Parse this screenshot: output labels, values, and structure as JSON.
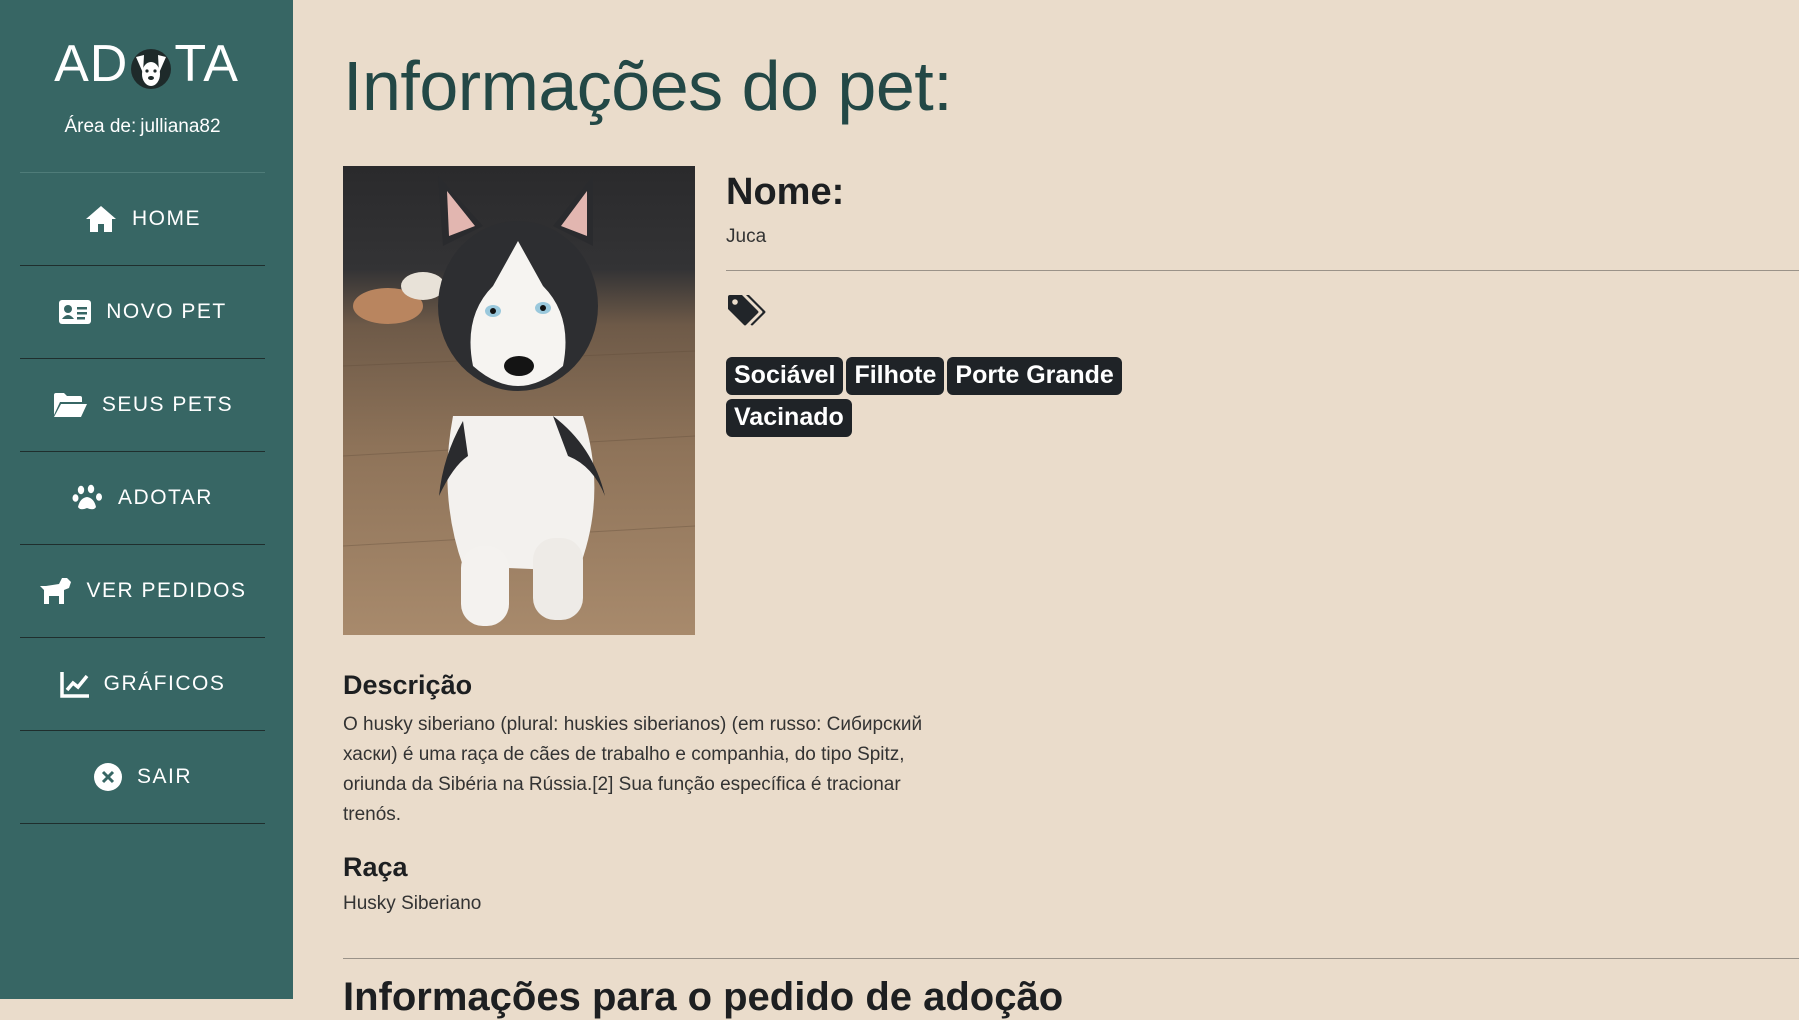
{
  "sidebar": {
    "logo_left": "AD",
    "logo_right": "TA",
    "area_label": "Área de:",
    "username": "julliana82",
    "items": [
      {
        "label": "HOME",
        "icon": "home-icon"
      },
      {
        "label": "NOVO PET",
        "icon": "id-card-icon"
      },
      {
        "label": "SEUS PETS",
        "icon": "folder-open-icon"
      },
      {
        "label": "ADOTAR",
        "icon": "paw-icon"
      },
      {
        "label": "VER PEDIDOS",
        "icon": "dog-icon"
      },
      {
        "label": "GRÁFICOS",
        "icon": "chart-line-icon"
      },
      {
        "label": "SAIR",
        "icon": "close-circle-icon"
      }
    ]
  },
  "main": {
    "title": "Informações do pet:",
    "nome_label": "Nome:",
    "nome_value": "Juca",
    "tags": [
      "Sociável",
      "Filhote",
      "Porte Grande",
      "Vacinado"
    ],
    "descricao_label": "Descrição",
    "descricao_text": "O husky siberiano (plural: huskies siberianos) (em russo: Сибирский хаски) é uma raça de cães de trabalho e companhia, do tipo Spitz, oriunda da Sibéria na Rússia.[2] Sua função específica é tracionar trenós.",
    "raca_label": "Raça",
    "raca_value": "Husky Siberiano",
    "next_section_title": "Informações para o pedido de adoção"
  },
  "colors": {
    "sidebar_bg": "#376664",
    "page_bg": "#eadccb",
    "title_color": "#234846",
    "tag_bg": "#1f2327"
  }
}
